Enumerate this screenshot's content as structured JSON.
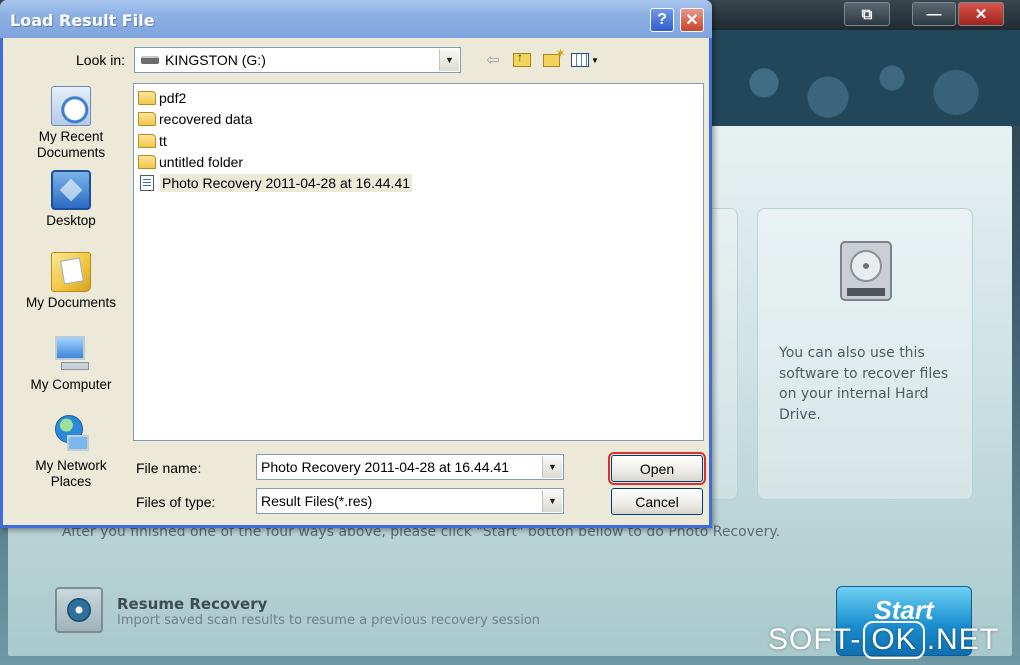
{
  "background_app": {
    "panel_text": "You can also use this software to recover files on your internal Hard Drive.",
    "hint_text": "After you finished one of the four ways above, please click \"Start\" botton bellow to do Photo Recovery.",
    "resume_title": "Resume Recovery",
    "resume_subtitle": "Import saved scan results to resume a previous recovery session",
    "start_label": "Start",
    "window_controls": {
      "restore": "⧉",
      "minimize": "—",
      "close": "✕"
    }
  },
  "watermark": {
    "left": "SOFT-",
    "ok": "OK",
    "right": ".NET"
  },
  "dialog": {
    "title": "Load Result File",
    "help_label": "?",
    "close_label": "✕",
    "look_in_label": "Look in:",
    "look_in_value": "KINGSTON (G:)",
    "places": [
      {
        "label": "My Recent Documents",
        "icon": "recent-documents-icon"
      },
      {
        "label": "Desktop",
        "icon": "desktop-icon"
      },
      {
        "label": "My Documents",
        "icon": "my-documents-icon"
      },
      {
        "label": "My Computer",
        "icon": "my-computer-icon"
      },
      {
        "label": "My Network Places",
        "icon": "network-places-icon"
      }
    ],
    "files": [
      {
        "name": "pdf2",
        "type": "folder"
      },
      {
        "name": "recovered data",
        "type": "folder"
      },
      {
        "name": "tt",
        "type": "folder"
      },
      {
        "name": "untitled folder",
        "type": "folder"
      },
      {
        "name": "Photo Recovery 2011-04-28 at 16.44.41",
        "type": "file",
        "selected": true
      }
    ],
    "file_name_label": "File name:",
    "file_name_value": "Photo Recovery 2011-04-28 at 16.44.41",
    "file_type_label": "Files of type:",
    "file_type_value": "Result Files(*.res)",
    "open_label": "Open",
    "cancel_label": "Cancel",
    "highlight_color": "#d9332b",
    "accent_color": "#3d6ddc"
  }
}
